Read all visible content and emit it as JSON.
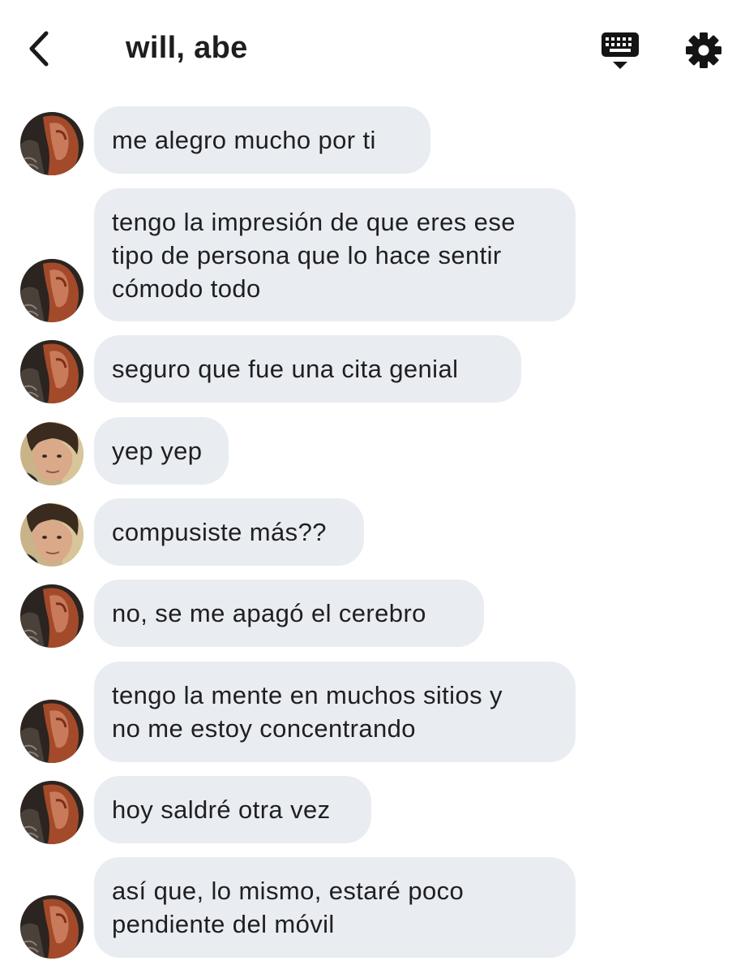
{
  "header": {
    "title": "will, abe",
    "back_icon": "chevron-left-icon",
    "keyboard_icon": "keyboard-icon",
    "settings_icon": "gear-icon"
  },
  "avatars": {
    "abe": "avatar-red-hair",
    "will": "avatar-dark-hair"
  },
  "messages": [
    {
      "sender": "abe",
      "text": "me alegro mucho por ti"
    },
    {
      "sender": "abe",
      "text": "tengo la impresión de que eres ese\ntipo de persona que lo hace sentir\ncómodo todo"
    },
    {
      "sender": "abe",
      "text": "seguro que fue una cita genial"
    },
    {
      "sender": "will",
      "text": "yep yep"
    },
    {
      "sender": "will",
      "text": "compusiste más??"
    },
    {
      "sender": "abe",
      "text": "no, se me apagó el cerebro"
    },
    {
      "sender": "abe",
      "text": "tengo la mente en muchos sitios y\nno me estoy concentrando"
    },
    {
      "sender": "abe",
      "text": "hoy saldré otra vez"
    },
    {
      "sender": "abe",
      "text": "así que, lo mismo, estaré poco\npendiente del móvil"
    }
  ]
}
